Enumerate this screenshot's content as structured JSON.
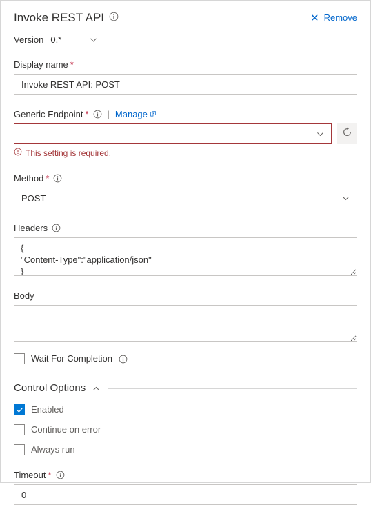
{
  "header": {
    "title": "Invoke REST API",
    "info_icon": "info-icon",
    "remove_label": "Remove",
    "remove_icon": "close-icon"
  },
  "version": {
    "label": "Version",
    "value": "0.*",
    "chevron_icon": "chevron-down-icon"
  },
  "display_name": {
    "label": "Display name",
    "required": "*",
    "value": "Invoke REST API: POST"
  },
  "generic_endpoint": {
    "label": "Generic Endpoint",
    "required": "*",
    "info_icon": "info-icon",
    "separator": "|",
    "manage_label": "Manage",
    "manage_icon": "external-link-icon",
    "value": "",
    "chevron_icon": "chevron-down-icon",
    "refresh_icon": "refresh-icon",
    "error_icon": "error-circle-icon",
    "error_text": "This setting is required."
  },
  "method": {
    "label": "Method",
    "required": "*",
    "info_icon": "info-icon",
    "value": "POST",
    "chevron_icon": "chevron-down-icon"
  },
  "headers": {
    "label": "Headers",
    "info_icon": "info-icon",
    "value": "{\n\"Content-Type\":\"application/json\"\n}"
  },
  "body": {
    "label": "Body",
    "value": ""
  },
  "wait_for_completion": {
    "label": "Wait For Completion",
    "checked": false,
    "info_icon": "info-icon"
  },
  "control_options": {
    "title": "Control Options",
    "chevron_icon": "chevron-up-icon",
    "items": [
      {
        "label": "Enabled",
        "checked": true
      },
      {
        "label": "Continue on error",
        "checked": false
      },
      {
        "label": "Always run",
        "checked": false
      }
    ]
  },
  "timeout": {
    "label": "Timeout",
    "required": "*",
    "info_icon": "info-icon",
    "value": "0"
  },
  "colors": {
    "accent": "#0078d4",
    "link": "#0066cc",
    "error": "#a4373a",
    "required_star": "#c4314b",
    "border": "#c8c6c4"
  }
}
